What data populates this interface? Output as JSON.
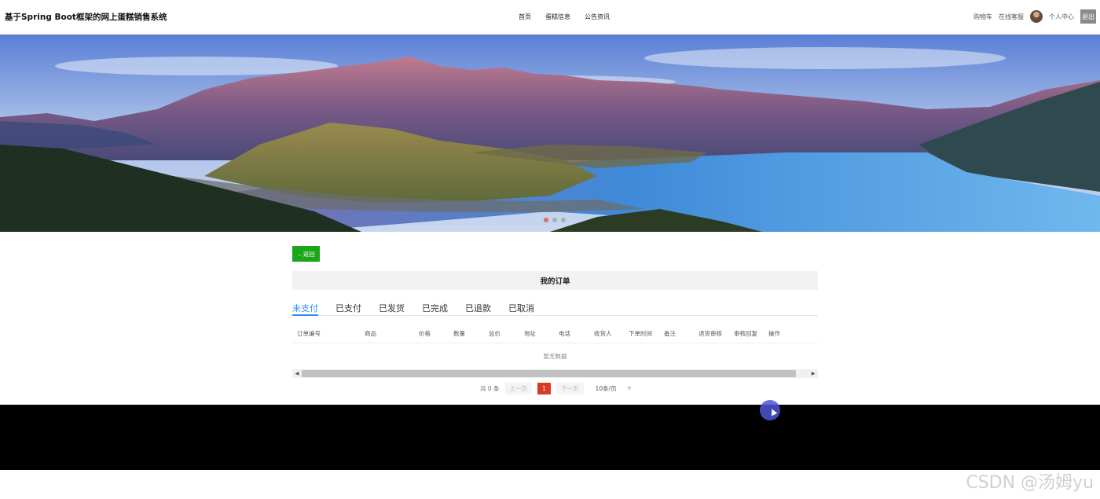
{
  "header": {
    "site_title": "基于Spring Boot框架的网上蛋糕销售系统",
    "nav": [
      "首页",
      "蛋糕信息",
      "公告资讯"
    ],
    "right": {
      "cart": "购物车",
      "service": "在线客服",
      "profile": "个人中心",
      "logout": "退出"
    }
  },
  "banner": {
    "slide_count": 3,
    "active_slide": 1
  },
  "page": {
    "back_label": "←返回",
    "title": "我的订单",
    "tabs": [
      {
        "label": "未支付",
        "active": true
      },
      {
        "label": "已支付",
        "active": false
      },
      {
        "label": "已发货",
        "active": false
      },
      {
        "label": "已完成",
        "active": false
      },
      {
        "label": "已退款",
        "active": false
      },
      {
        "label": "已取消",
        "active": false
      }
    ],
    "columns": [
      "订单编号",
      "商品",
      "价格",
      "数量",
      "总价",
      "地址",
      "电话",
      "收货人",
      "下单时间",
      "备注",
      "退货审核",
      "审核回复",
      "操作"
    ],
    "empty_text": "暂无数据"
  },
  "pagination": {
    "total": "共 0 条",
    "prev": "上一页",
    "current": "1",
    "next": "下一页",
    "page_size": "10条/页"
  },
  "watermark": "CSDN @汤姆yu",
  "colors": {
    "accent": "#2d8cf0",
    "back_button": "#1aa51a",
    "current_page": "#d93a25",
    "footer": "#000000"
  }
}
